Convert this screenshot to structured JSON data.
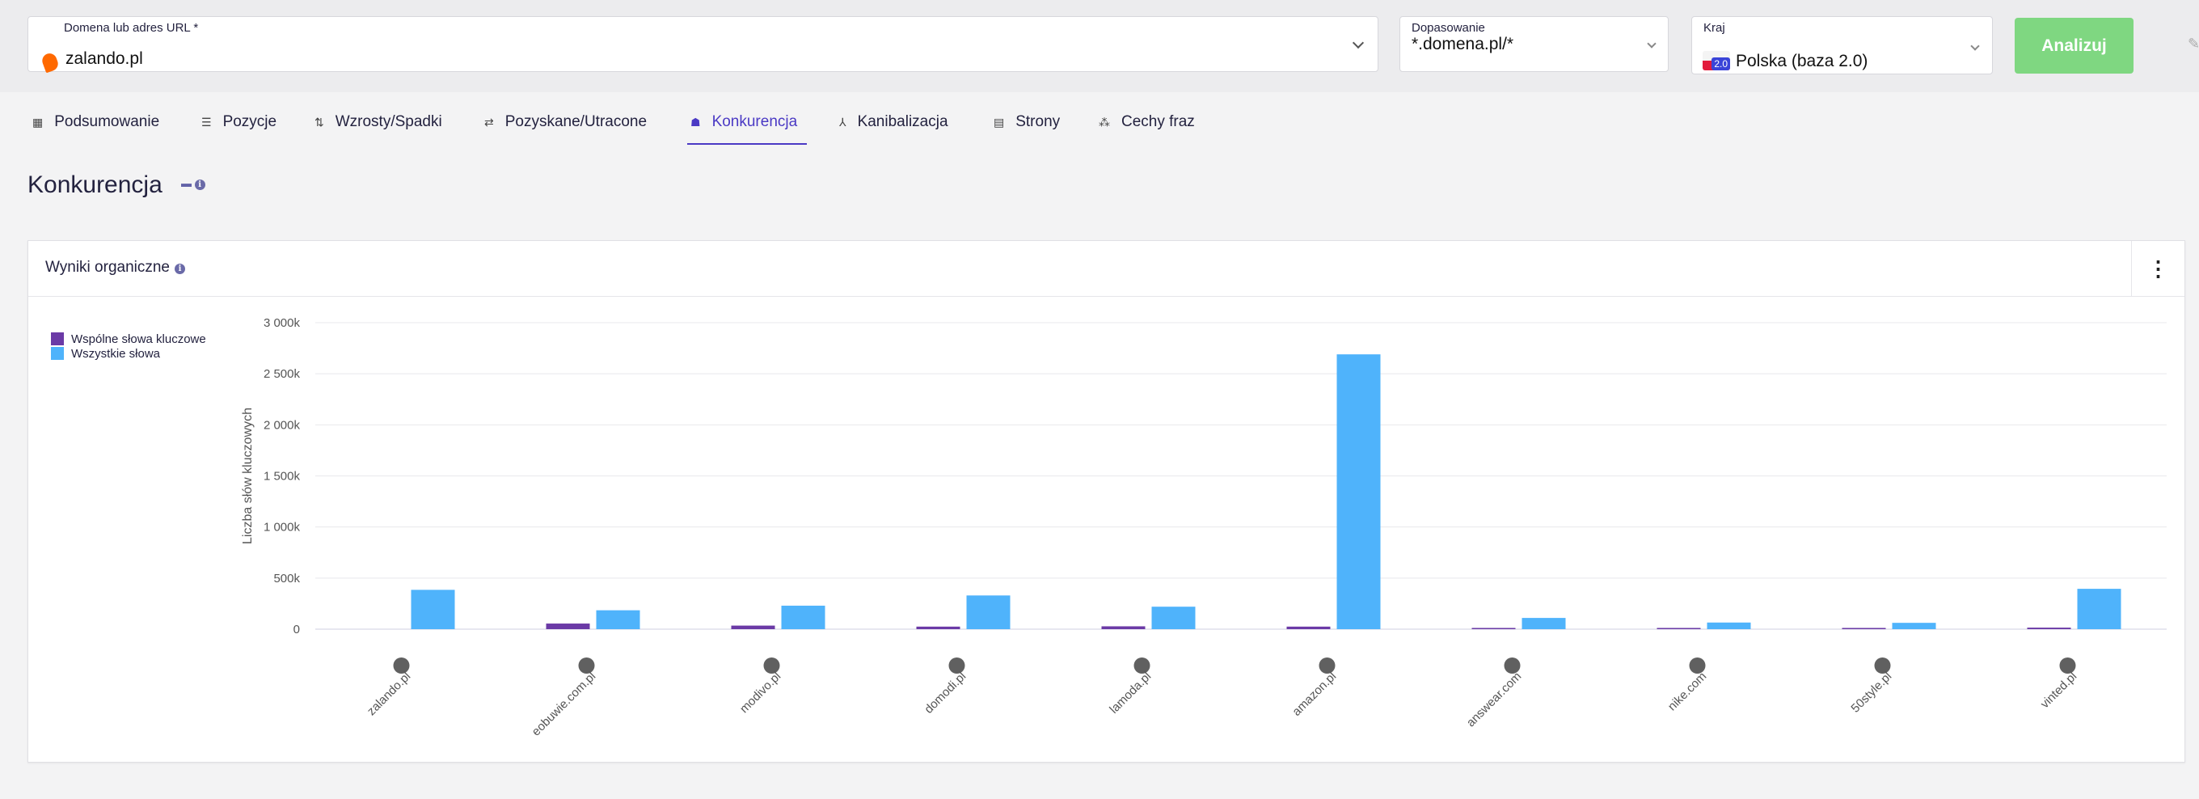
{
  "search": {
    "domain_label": "Domena lub adres URL *",
    "domain_value": "zalando.pl",
    "match_label": "Dopasowanie",
    "match_value": "*.domena.pl/*",
    "country_label": "Kraj",
    "country_badge": "2.0",
    "country_value": "Polska (baza 2.0)",
    "analyze_button": "Analizuj"
  },
  "tabs": [
    {
      "label": "Podsumowanie",
      "icon": "dashboard-icon"
    },
    {
      "label": "Pozycje",
      "icon": "list-icon"
    },
    {
      "label": "Wzrosty/Spadki",
      "icon": "up-down-icon"
    },
    {
      "label": "Pozyskane/Utracone",
      "icon": "swap-icon"
    },
    {
      "label": "Konkurencja",
      "icon": "people-icon",
      "active": true
    },
    {
      "label": "Kanibalizacja",
      "icon": "split-icon"
    },
    {
      "label": "Strony",
      "icon": "pages-icon"
    },
    {
      "label": "Cechy fraz",
      "icon": "shapes-icon"
    }
  ],
  "page": {
    "title": "Konkurencja"
  },
  "card": {
    "title": "Wyniki organiczne"
  },
  "colors": {
    "common": "#6b3aa6",
    "all": "#4fb3fb",
    "accent": "#4a39c4",
    "analyze": "#7fd781"
  },
  "chart_data": {
    "type": "bar",
    "ylabel": "Liczba słów kluczowych",
    "ylim": [
      0,
      3000000
    ],
    "yticks": [
      "0",
      "500k",
      "1 000k",
      "1 500k",
      "2 000k",
      "2 500k",
      "3 000k"
    ],
    "legend_position": "top-left",
    "grid": true,
    "categories": [
      "zalando.pl",
      "eobuwie.com.pl",
      "modivo.pl",
      "domodi.pl",
      "lamoda.pl",
      "amazon.pl",
      "answear.com",
      "nike.com",
      "50style.pl",
      "vinted.pl"
    ],
    "series": [
      {
        "name": "Wspólne słowa kluczowe",
        "values": [
          0,
          55000,
          35000,
          25000,
          28000,
          25000,
          12000,
          12000,
          12000,
          15000
        ]
      },
      {
        "name": "Wszystkie słowa",
        "values": [
          385000,
          185000,
          230000,
          330000,
          220000,
          2690000,
          110000,
          65000,
          62000,
          395000
        ]
      }
    ]
  }
}
